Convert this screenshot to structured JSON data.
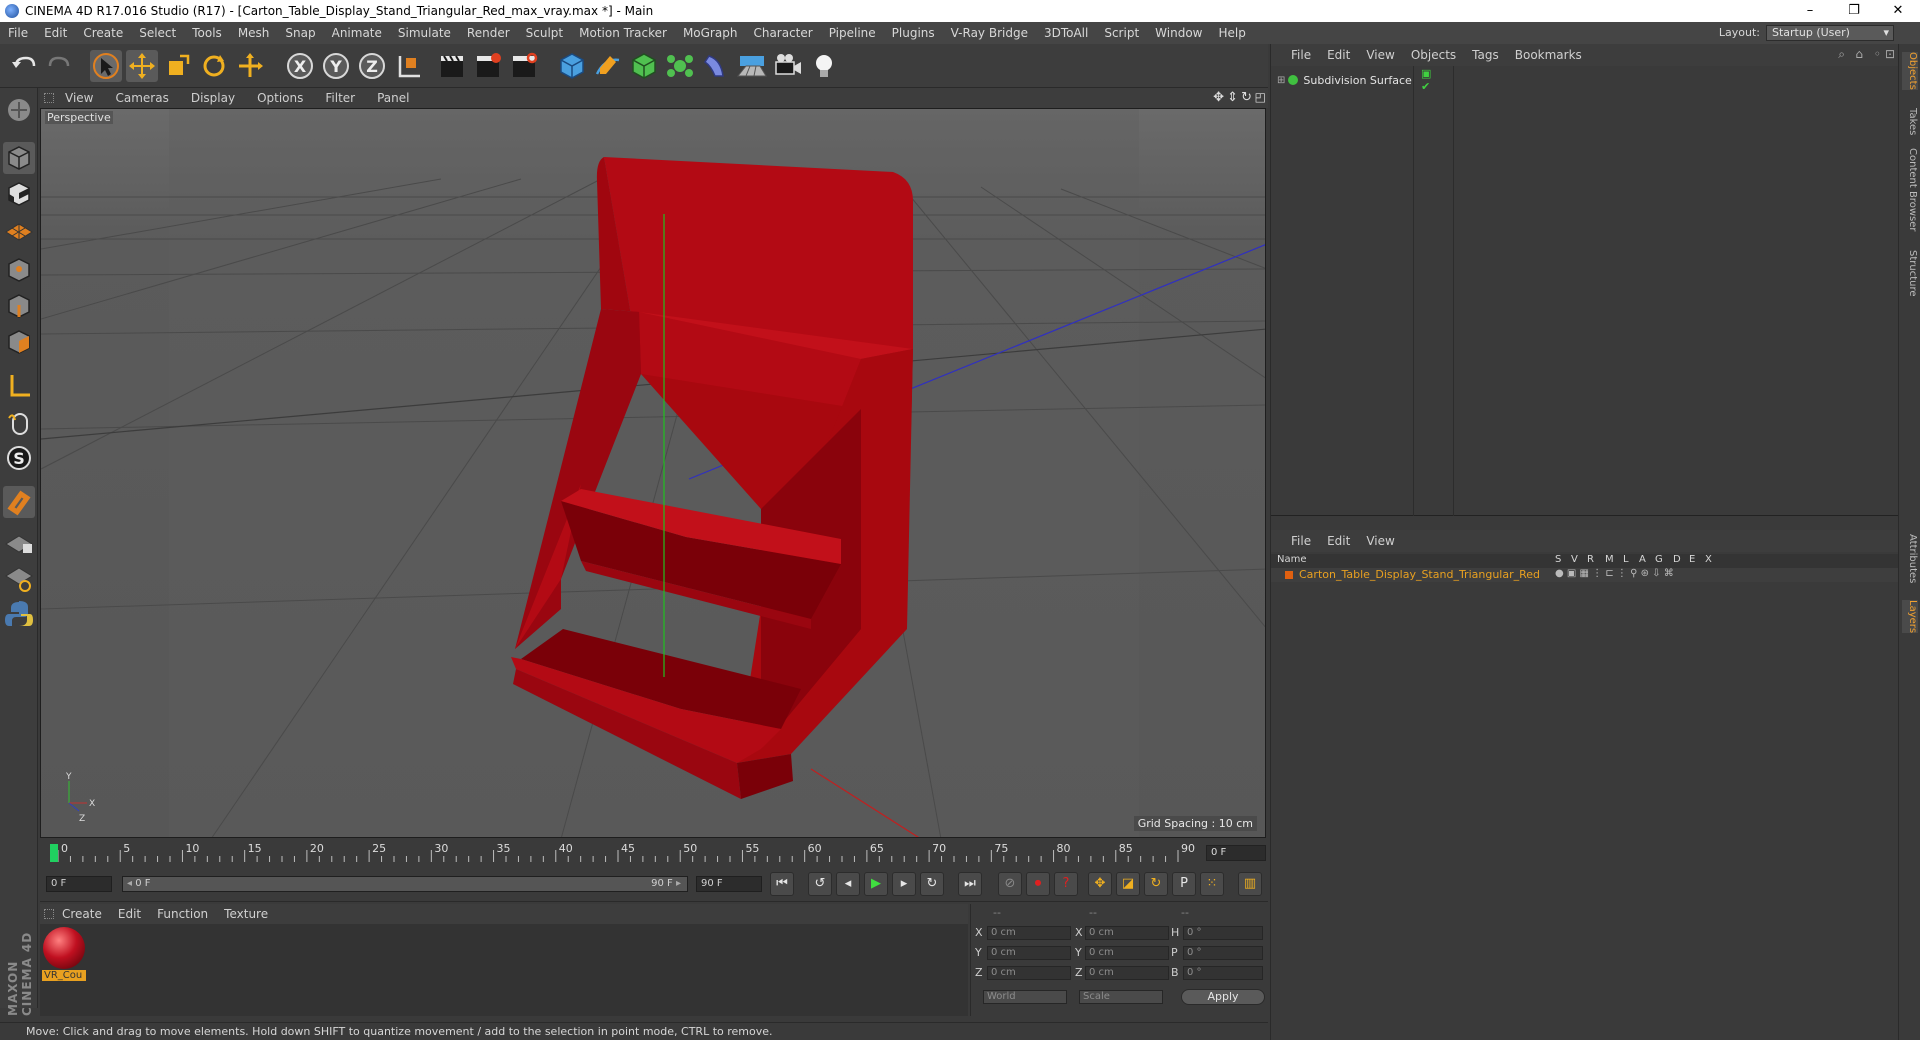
{
  "window": {
    "title": "CINEMA 4D R17.016 Studio (R17) - [Carton_Table_Display_Stand_Triangular_Red_max_vray.max *] - Main",
    "minimize": "–",
    "restore": "❐",
    "close": "✕"
  },
  "menubar": [
    "File",
    "Edit",
    "Create",
    "Select",
    "Tools",
    "Mesh",
    "Snap",
    "Animate",
    "Simulate",
    "Render",
    "Sculpt",
    "Motion Tracker",
    "MoGraph",
    "Character",
    "Pipeline",
    "Plugins",
    "V-Ray Bridge",
    "3DToAll",
    "Script",
    "Window",
    "Help"
  ],
  "layout": {
    "label": "Layout:",
    "value": "Startup (User)"
  },
  "viewport": {
    "menu": [
      "View",
      "Cameras",
      "Display",
      "Options",
      "Filter",
      "Panel"
    ],
    "label": "Perspective",
    "grid_spacing": "Grid Spacing : 10 cm",
    "axis_x": "X",
    "axis_y": "Y",
    "axis_z": "Z",
    "colors": {
      "object": "#b30a14",
      "object_dark": "#7a0008",
      "background": "#5c5c5c"
    }
  },
  "timeline": {
    "ticks": [
      "0",
      "5",
      "10",
      "15",
      "20",
      "25",
      "30",
      "35",
      "40",
      "45",
      "50",
      "55",
      "60",
      "65",
      "70",
      "75",
      "80",
      "85",
      "90"
    ],
    "current_frame": "0 F"
  },
  "transport": {
    "start_frame": "0 F",
    "range_start": "0 F",
    "range_end": "90 F",
    "end_frame": "90 F"
  },
  "material_manager": {
    "menu": [
      "Create",
      "Edit",
      "Function",
      "Texture"
    ],
    "materials": [
      {
        "name": "VR_Cou"
      }
    ]
  },
  "coordinates": {
    "header": [
      "--",
      "--",
      "--"
    ],
    "rows": [
      {
        "a": "X",
        "av": "0 cm",
        "b": "X",
        "bv": "0 cm",
        "c": "H",
        "cv": "0 °"
      },
      {
        "a": "Y",
        "av": "0 cm",
        "b": "Y",
        "bv": "0 cm",
        "c": "P",
        "cv": "0 °"
      },
      {
        "a": "Z",
        "av": "0 cm",
        "b": "Z",
        "bv": "0 cm",
        "c": "B",
        "cv": "0 °"
      }
    ],
    "space": "World",
    "mode": "Scale",
    "apply": "Apply"
  },
  "status": "Move: Click and drag to move elements. Hold down SHIFT to quantize movement / add to the selection in point mode, CTRL to remove.",
  "brand": "MAXON CINEMA 4D",
  "object_manager": {
    "menu": [
      "File",
      "Edit",
      "View",
      "Objects",
      "Tags",
      "Bookmarks"
    ],
    "objects": [
      {
        "name": "Subdivision Surface"
      }
    ]
  },
  "layer_manager": {
    "menu": [
      "File",
      "Edit",
      "View"
    ],
    "columns": [
      "Name",
      "S",
      "V",
      "R",
      "M",
      "L",
      "A",
      "G",
      "D",
      "E",
      "X"
    ],
    "layers": [
      {
        "name": "Carton_Table_Display_Stand_Triangular_Red",
        "color": "#e06010"
      }
    ]
  },
  "side_tabs": [
    "Objects",
    "Takes",
    "Content Browser",
    "Structure",
    "Attributes",
    "Layers"
  ]
}
